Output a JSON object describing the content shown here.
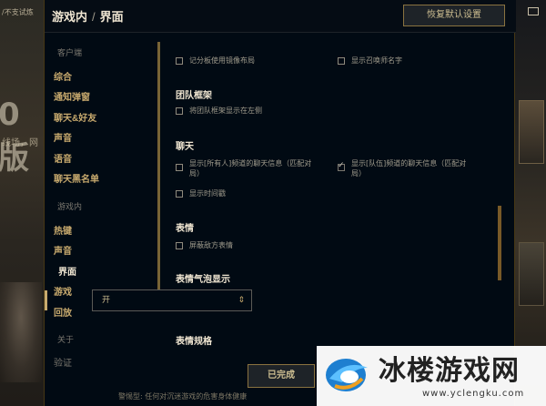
{
  "background": {
    "corner_text": "/不支试炼",
    "big_text": "0版",
    "small_text": "线场，网"
  },
  "window": {
    "title_part1": "游戏内",
    "title_sep": "/",
    "title_part2": "界面",
    "restore_defaults": "恢复默认设置"
  },
  "sidebar": {
    "client_header": "客户端",
    "client_items": [
      "综合",
      "通知弹窗",
      "聊天&好友",
      "声音",
      "语音",
      "聊天黑名单"
    ],
    "ingame_header": "游戏内",
    "ingame_items": [
      "热键",
      "声音",
      "界面",
      "游戏",
      "回放"
    ],
    "about_header": "关于",
    "about_items": [
      "验证"
    ],
    "active_item": "界面"
  },
  "content": {
    "opt_scoreboard_mirror": {
      "label": "记分板使用镜像布局",
      "checked": false
    },
    "opt_show_summoner_names": {
      "label": "显示召唤师名字",
      "checked": false
    },
    "team_frames_title": "团队框架",
    "opt_team_frames_left": {
      "label": "将团队框架显示在左侧",
      "checked": false
    },
    "chat_title": "聊天",
    "opt_all_chat": {
      "label_line1": "显示[所有人]频道的聊天信息（匹配对",
      "label_line2": "局）",
      "checked": false
    },
    "opt_team_chat": {
      "label_line1": "显示[队伍]频道的聊天信息（匹配对",
      "label_line2": "局）",
      "checked": true
    },
    "opt_show_timestamps": {
      "label": "显示时间戳",
      "checked": false
    },
    "emotes_title": "表情",
    "opt_block_enemy_emotes": {
      "label": "屏蔽敌方表情",
      "checked": false
    },
    "emote_bubble_title": "表情气泡显示",
    "emote_bubble_value": "开",
    "emote_size_title": "表情规格"
  },
  "footer": {
    "done_label": "已完成",
    "note": "警惕型: 任何对沉迷游戏的危害身体健康"
  },
  "watermark": {
    "title": "冰楼游戏网",
    "url": "www.yclengku.com"
  },
  "colors": {
    "gold": "#c8aa6e",
    "panel_bg": "#010a13",
    "text_light": "#f0e6d2"
  }
}
